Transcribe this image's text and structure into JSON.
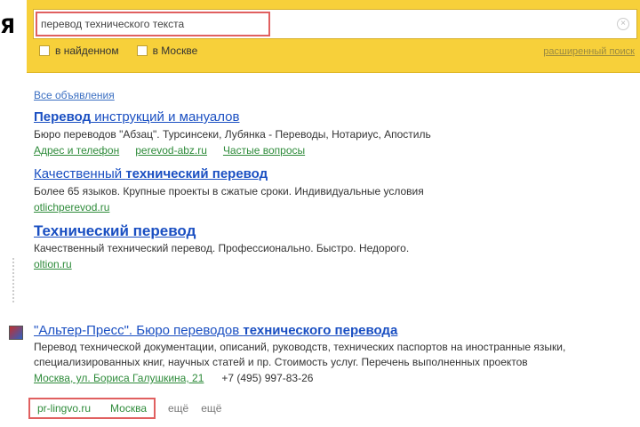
{
  "logo_fragment": "Я",
  "search": {
    "query": "перевод технического текста",
    "filter_1": "в найденном",
    "filter_2": "в Москве",
    "advanced": "расширенный поиск"
  },
  "results": {
    "all_ads": "Все объявления",
    "items": [
      {
        "title_link": "Перевод",
        "title_rest": " инструкций и мануалов",
        "snippet": "Бюро переводов \"Абзац\". Турсинсеки, Лубянка - Переводы, Нотариус, Апостиль",
        "urls": [
          "Адрес и телефон",
          "perevod-abz.ru",
          "Частые вопросы"
        ]
      },
      {
        "title_pre": "Качественный ",
        "title_bold": "технический перевод",
        "snippet": "Более 65 языков. Крупные проекты в сжатые сроки. Индивидуальные условия",
        "urls": [
          "otlichperevod.ru"
        ]
      },
      {
        "title_bold": "Технический перевод",
        "snippet": "Качественный технический перевод. Профессионально. Быстро. Недорого.",
        "urls": [
          "oltion.ru"
        ]
      }
    ]
  },
  "organization": {
    "title_pre": "\"Альтер-Пресс\". Бюро переводов ",
    "title_bold": "технического перевода",
    "snippet_1": "Перевод технической документации, описаний, руководств, технических паспортов на иностранные языки,",
    "snippet_2": "специализированных книг, научных статей и пр. Стоимость услуг. Перечень выполненных проектов",
    "address": "Москва, ул. Бориса Галушкина, 21",
    "phone": "+7 (495) 997-83-26",
    "tags": [
      "pr-lingvo.ru",
      "Москва"
    ],
    "extra_tags": [
      "ещё",
      "ещё"
    ]
  }
}
